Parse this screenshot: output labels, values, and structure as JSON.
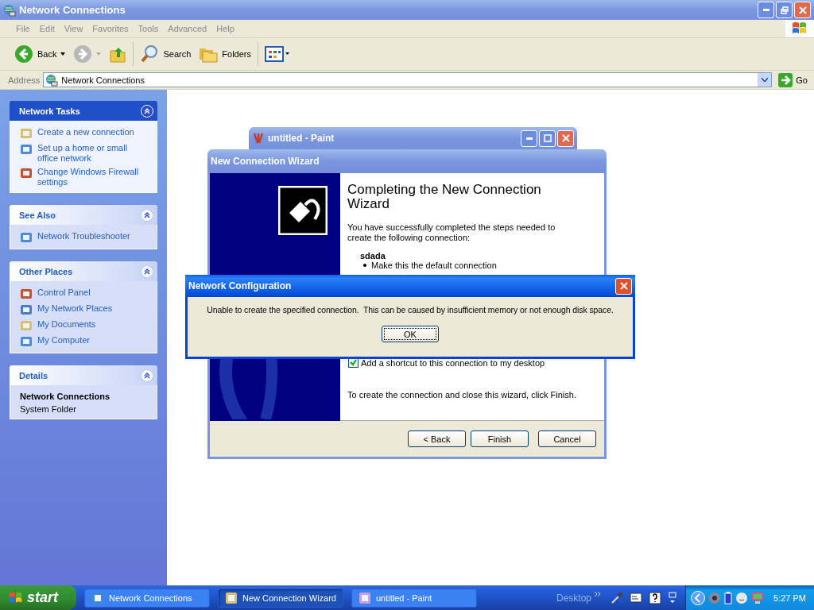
{
  "window": {
    "title": "Network Connections",
    "menu": [
      "File",
      "Edit",
      "View",
      "Favorites",
      "Tools",
      "Advanced",
      "Help"
    ],
    "toolbar": [
      {
        "kind": "back",
        "label": "Back"
      },
      {
        "kind": "forward"
      },
      {
        "kind": "up"
      },
      {
        "kind": "search",
        "label": "Search"
      },
      {
        "kind": "folders",
        "label": "Folders"
      },
      {
        "kind": "views"
      }
    ],
    "address": {
      "label": "Address",
      "value": "Network Connections",
      "go": "Go"
    }
  },
  "sidebar": [
    {
      "title": "Network Tasks",
      "kind": "primary",
      "items": [
        "Create a new connection",
        "Set up a home or small office network",
        "Change Windows Firewall settings"
      ]
    },
    {
      "title": "See Also",
      "kind": "normal",
      "items": [
        "Network Troubleshooter"
      ]
    },
    {
      "title": "Other Places",
      "kind": "normal",
      "items": [
        "Control Panel",
        "My Network Places",
        "My Documents",
        "My Computer"
      ]
    },
    {
      "title": "Details",
      "kind": "details",
      "name": "Network Connections",
      "subtitle": "System Folder"
    }
  ],
  "paint_window": {
    "title": "untitled - Paint"
  },
  "wizard": {
    "title": "New Connection Wizard",
    "heading": "Completing the New Connection Wizard",
    "intro": "You have successfully completed the steps needed to create the following connection:",
    "connection_name": "sdada",
    "options": [
      "Make this the default connection"
    ],
    "shortcut": {
      "label": "Add a shortcut to this connection to my desktop",
      "checked": true
    },
    "finish_note": "To create the connection and close this wizard, click Finish.",
    "buttons": [
      "< Back",
      "Finish",
      "Cancel"
    ]
  },
  "dialog": {
    "title": "Network Configuration",
    "message": "Unable to create the specified connection.  This can be caused by insufficient memory or not enough disk space.",
    "button": "OK"
  },
  "taskbar": {
    "start": "start",
    "tasks": [
      {
        "label": "Network Connections",
        "selected": false
      },
      {
        "label": "New Connection Wizard",
        "selected": true
      },
      {
        "label": "untitled - Paint",
        "selected": false
      }
    ],
    "toolbar_label": "Desktop",
    "clock": "5:27 PM"
  }
}
